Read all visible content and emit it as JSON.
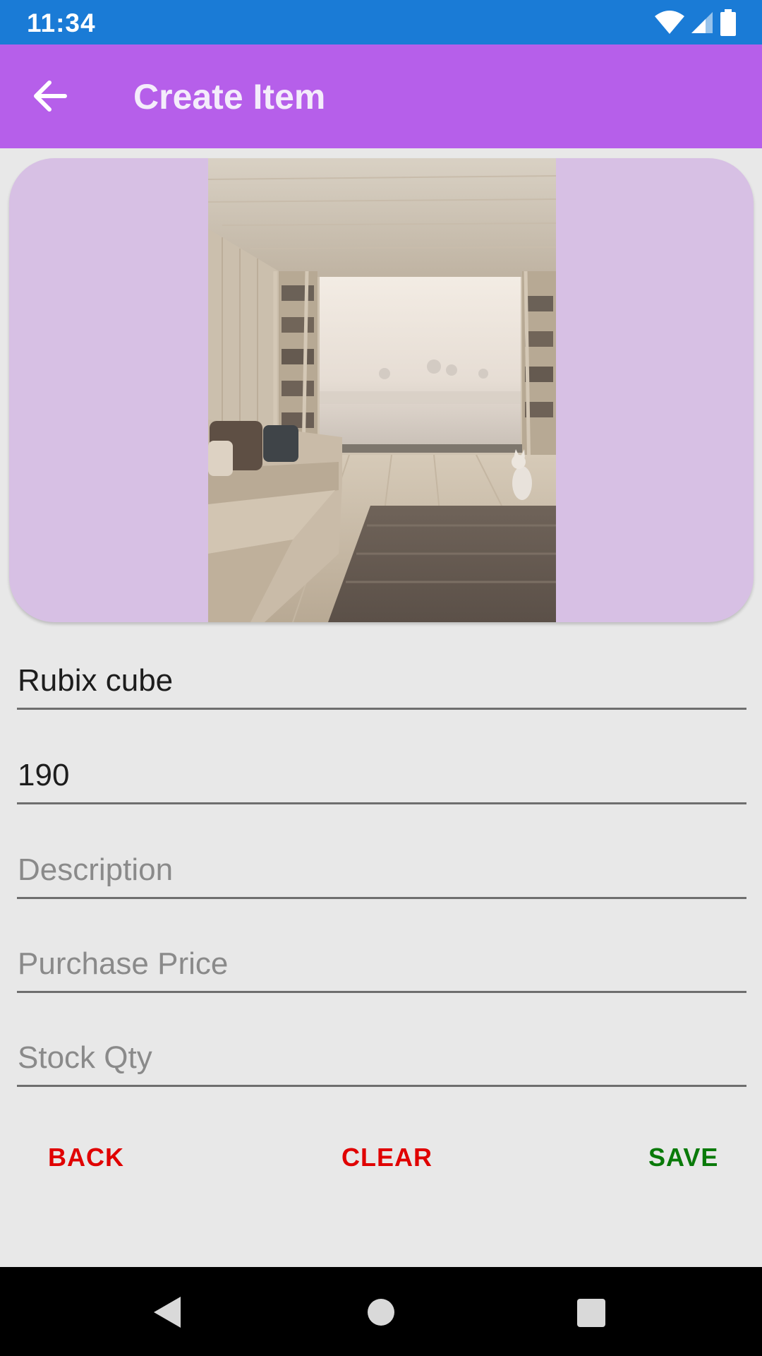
{
  "status_bar": {
    "time": "11:34"
  },
  "app_bar": {
    "title": "Create Item"
  },
  "form": {
    "name_value": "Rubix cube",
    "price_value": "190",
    "description_placeholder": "Description",
    "purchase_price_placeholder": "Purchase Price",
    "stock_qty_placeholder": "Stock Qty"
  },
  "buttons": {
    "back_label": "BACK",
    "clear_label": "CLEAR",
    "save_label": "SAVE"
  },
  "colors": {
    "status_bar": "#1a7bd6",
    "app_bar": "#b65fea",
    "image_card": "#d7c0e4",
    "back_clear": "#e00000",
    "save": "#0a7a0a"
  }
}
